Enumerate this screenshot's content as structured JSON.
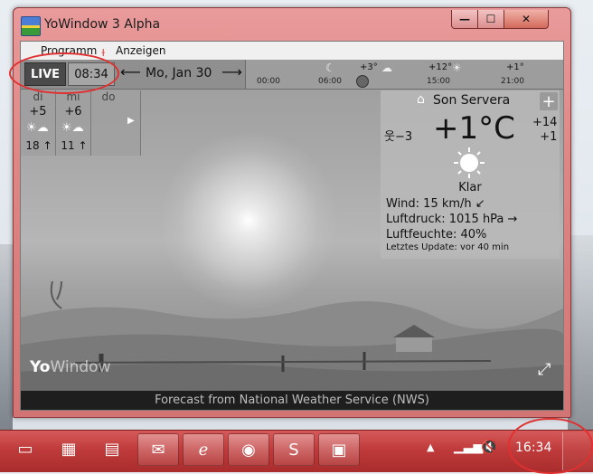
{
  "window": {
    "title": "YoWindow 3 Alpha",
    "min": "—",
    "max": "☐",
    "close": "✕"
  },
  "menu": {
    "programm": "Programm",
    "anzeigen": "Anzeigen"
  },
  "toolbar": {
    "live": "LIVE",
    "time": "08:34",
    "date": "Mo, Jan 30",
    "left_arrow": "⟵",
    "right_arrow": "⟶",
    "timeline": {
      "labels": [
        "00:00",
        "06:00",
        "15:00",
        "21:00"
      ],
      "temps": [
        "+3°",
        "+12°",
        "+1°"
      ]
    }
  },
  "forecast": {
    "days": [
      {
        "day": "di",
        "high": "+5",
        "low": "18 ↑"
      },
      {
        "day": "mi",
        "high": "+6",
        "low": "11 ↑"
      },
      {
        "day": "do",
        "high": "",
        "low": ""
      }
    ],
    "next_icon": "▶"
  },
  "current": {
    "location": "Son Servera",
    "feels_like": "−3",
    "temperature": "+1°C",
    "high": "+14",
    "low": "+1",
    "condition": "Klar",
    "wind": "Wind:  15 km/h ↙",
    "pressure": "Luftdruck:  1015 hPa →",
    "humidity": "Luftfeuchte:  40%",
    "updated": "Letztes Update:   vor 40 min"
  },
  "logo": {
    "yo": "Yo",
    "window": "Window"
  },
  "footer": {
    "text": "Forecast from National Weather Service (NWS)"
  },
  "taskbar": {
    "clock": "16:34"
  },
  "colors": {
    "accent": "#e03030",
    "taskbar": "#c03b3b",
    "scene": "#a9a9a9"
  }
}
